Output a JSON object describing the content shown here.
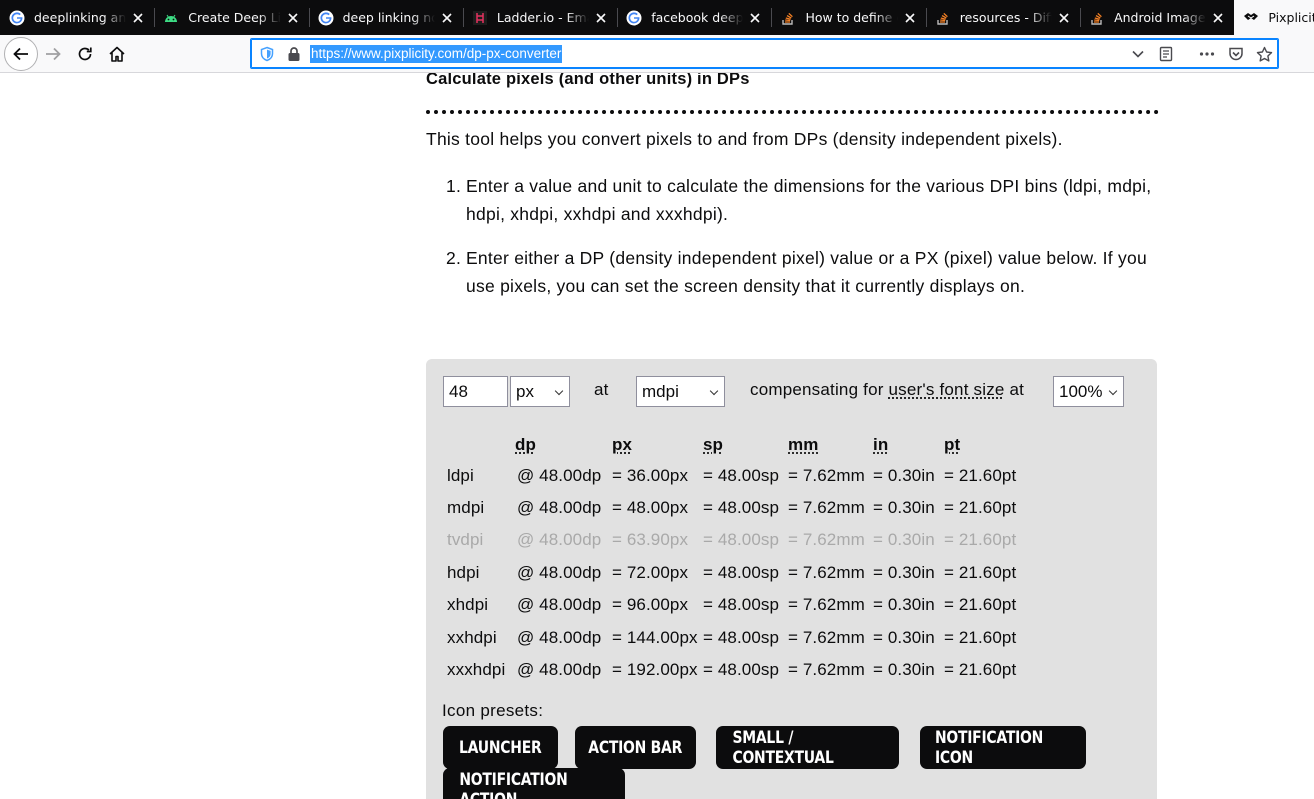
{
  "browser": {
    "tabs": [
      {
        "title": "deeplinking android",
        "icon": "google-icon"
      },
      {
        "title": "Create Deep Links",
        "icon": "android-icon"
      },
      {
        "title": "deep linking not working",
        "icon": "google-icon"
      },
      {
        "title": "Ladder.io - Email",
        "icon": "ladder-icon"
      },
      {
        "title": "facebook deep linking",
        "icon": "google-icon"
      },
      {
        "title": "How to define dimens",
        "icon": "stackoverflow-icon"
      },
      {
        "title": "resources - Difference",
        "icon": "stackoverflow-icon"
      },
      {
        "title": "Android ImageView",
        "icon": "stackoverflow-icon"
      },
      {
        "title": "Pixplicity",
        "icon": "pixplicity-icon",
        "active": true
      }
    ],
    "url": "https://www.pixplicity.com/dp-px-converter"
  },
  "page": {
    "heading": "Calculate pixels (and other units) in DPs",
    "intro": "This tool helps you convert pixels to and from DPs (density independent pixels).",
    "steps": [
      {
        "num": "1.",
        "text": "Enter a value and unit to calculate the dimensions for the various DPI bins (ldpi, mdpi, hdpi, xhdpi, xxhdpi and xxxhdpi)."
      },
      {
        "num": "2.",
        "text": "Enter either a DP (density independent pixel) value or a PX (pixel) value below. If you use pixels, you can set the screen density that it currently displays on."
      }
    ]
  },
  "calculator": {
    "value": "48",
    "unit": "px",
    "at_label": "at",
    "density": "mdpi",
    "compensating_prefix": "compensating for ",
    "font_size_link": "user's font size",
    "compensating_suffix": " at",
    "scale": "100%",
    "columns": [
      "dp",
      "px",
      "sp",
      "mm",
      "in",
      "pt"
    ],
    "rows": [
      {
        "name": "ldpi",
        "dp": "@ 48.00dp",
        "px": "= 36.00px",
        "sp": "= 48.00sp",
        "mm": "= 7.62mm",
        "in": "= 0.30in",
        "pt": "= 21.60pt",
        "dim": false
      },
      {
        "name": "mdpi",
        "dp": "@ 48.00dp",
        "px": "= 48.00px",
        "sp": "= 48.00sp",
        "mm": "= 7.62mm",
        "in": "= 0.30in",
        "pt": "= 21.60pt",
        "dim": false
      },
      {
        "name": "tvdpi",
        "dp": "@ 48.00dp",
        "px": "= 63.90px",
        "sp": "= 48.00sp",
        "mm": "= 7.62mm",
        "in": "= 0.30in",
        "pt": "= 21.60pt",
        "dim": true
      },
      {
        "name": "hdpi",
        "dp": "@ 48.00dp",
        "px": "= 72.00px",
        "sp": "= 48.00sp",
        "mm": "= 7.62mm",
        "in": "= 0.30in",
        "pt": "= 21.60pt",
        "dim": false
      },
      {
        "name": "xhdpi",
        "dp": "@ 48.00dp",
        "px": "= 96.00px",
        "sp": "= 48.00sp",
        "mm": "= 7.62mm",
        "in": "= 0.30in",
        "pt": "= 21.60pt",
        "dim": false
      },
      {
        "name": "xxhdpi",
        "dp": "@ 48.00dp",
        "px": "= 144.00px",
        "sp": "= 48.00sp",
        "mm": "= 7.62mm",
        "in": "= 0.30in",
        "pt": "= 21.60pt",
        "dim": false
      },
      {
        "name": "xxxhdpi",
        "dp": "@ 48.00dp",
        "px": "= 192.00px",
        "sp": "= 48.00sp",
        "mm": "= 7.62mm",
        "in": "= 0.30in",
        "pt": "= 21.60pt",
        "dim": false
      }
    ],
    "presets_label": "Icon presets:",
    "presets": [
      "Launcher",
      "Action bar",
      "Small / Contextual",
      "Notification icon",
      "Notification action"
    ]
  }
}
